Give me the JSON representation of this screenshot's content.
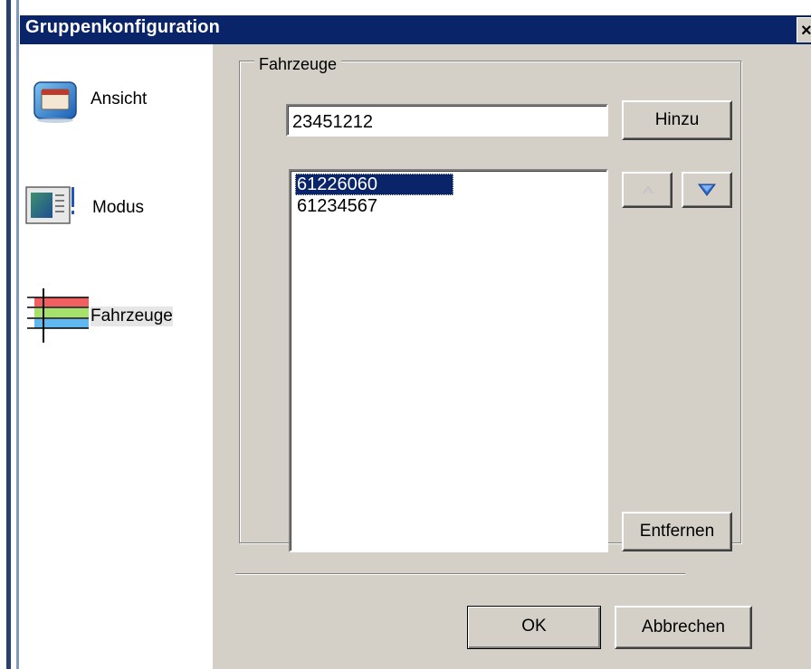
{
  "window": {
    "title": "Gruppenkonfiguration",
    "close_label": "×"
  },
  "nav": {
    "items": [
      {
        "label": "Ansicht",
        "icon": "window-view-icon",
        "selected": false
      },
      {
        "label": "Modus",
        "icon": "mode-screen-icon",
        "selected": false
      },
      {
        "label": "Fahrzeuge",
        "icon": "colored-lines-icon",
        "selected": true
      }
    ]
  },
  "vehicles": {
    "group_label": "Fahrzeuge",
    "input_value": "23451212",
    "add_label": "Hinzu",
    "remove_label": "Entfernen",
    "list": [
      "61226060",
      "61234567"
    ],
    "selected_index": 0,
    "up_icon": "arrow-up-icon",
    "down_icon": "arrow-down-icon",
    "up_enabled": false,
    "down_enabled": true
  },
  "dialog": {
    "ok_label": "OK",
    "cancel_label": "Abbrechen"
  },
  "colors": {
    "titlebar": "#0a246a",
    "face": "#d4d0c8",
    "selection": "#0a246a"
  }
}
